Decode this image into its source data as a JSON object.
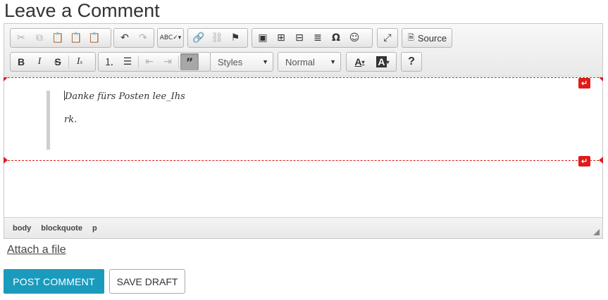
{
  "page": {
    "title": "Leave a Comment"
  },
  "toolbar": {
    "source_label": "Source",
    "styles_combo": "Styles",
    "format_combo": "Normal",
    "icons": {
      "cut": "cut-icon",
      "copy": "copy-icon",
      "paste": "paste-icon",
      "paste_text": "paste-text-icon",
      "paste_word": "paste-word-icon",
      "undo": "undo-icon",
      "redo": "redo-icon",
      "spellcheck": "spellcheck-icon",
      "link": "link-icon",
      "unlink": "unlink-icon",
      "anchor": "anchor-flag-icon",
      "image": "image-icon",
      "iframe": "iframe-icon",
      "table": "table-icon",
      "hr": "horizontal-rule-icon",
      "special_char": "omega-icon",
      "smiley": "smiley-icon",
      "maximize": "maximize-icon",
      "bold": "bold-icon",
      "italic": "italic-icon",
      "strike": "strikethrough-icon",
      "remove_format": "remove-format-icon",
      "numbered_list": "numbered-list-icon",
      "bulleted_list": "bulleted-list-icon",
      "outdent": "outdent-icon",
      "indent": "indent-icon",
      "blockquote": "blockquote-icon",
      "text_color": "text-color-icon",
      "bg_color": "background-color-icon",
      "help": "help-icon"
    }
  },
  "content": {
    "paragraphs": [
      "Danke fürs Posten lee_Ihs",
      "rk."
    ]
  },
  "pathbar": {
    "items": [
      "body",
      "blockquote",
      "p"
    ]
  },
  "attach_label": "Attach a file",
  "buttons": {
    "post": "POST COMMENT",
    "draft": "SAVE DRAFT"
  },
  "colors": {
    "accent": "#1a9bbd",
    "marker": "#e01b1b"
  }
}
